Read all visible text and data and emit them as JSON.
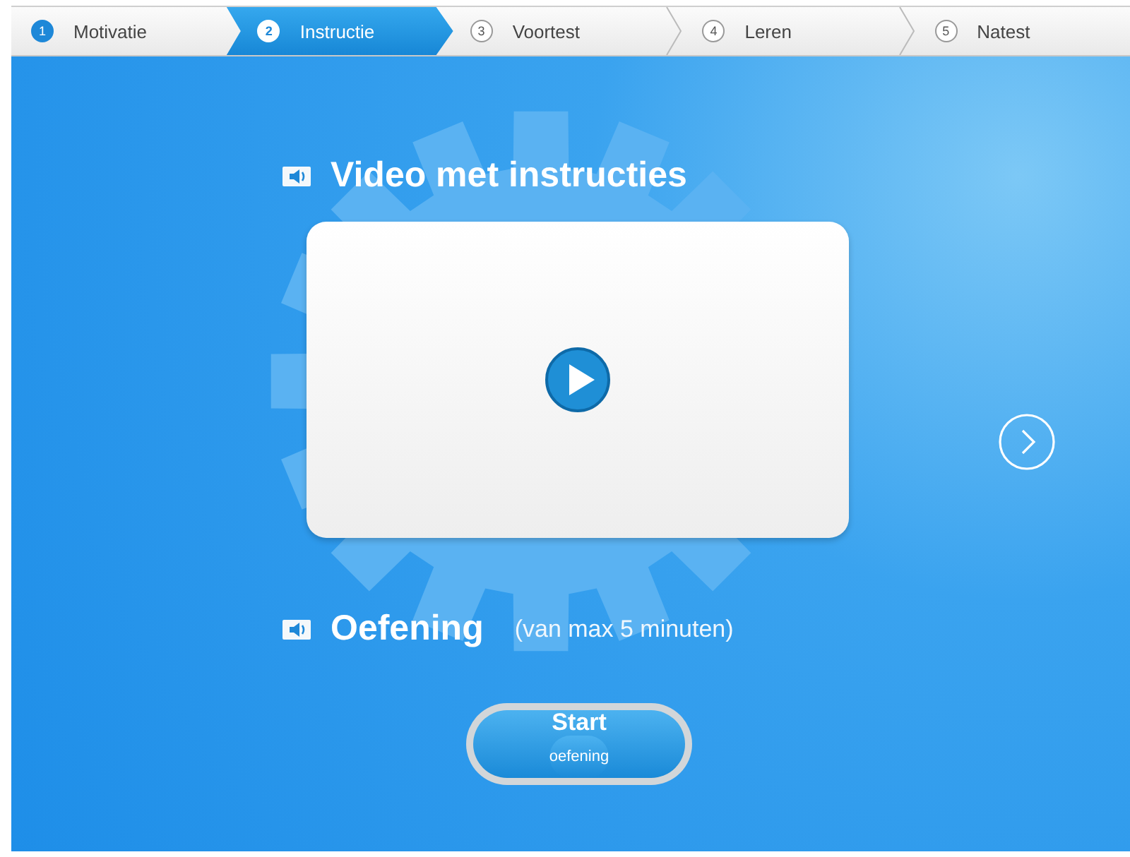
{
  "steps": [
    {
      "number": "1",
      "label": "Motivatie",
      "done": true,
      "selected": false
    },
    {
      "number": "2",
      "label": "Instructie",
      "done": false,
      "selected": true
    },
    {
      "number": "3",
      "label": "Voortest",
      "done": false,
      "selected": false
    },
    {
      "number": "4",
      "label": "Leren",
      "done": false,
      "selected": false
    },
    {
      "number": "5",
      "label": "Natest",
      "done": false,
      "selected": false
    }
  ],
  "video_section": {
    "title": "Video met instructies"
  },
  "exercise_section": {
    "title": "Oefening",
    "note": "(van max 5 minuten)"
  },
  "start_button": {
    "label": "Start",
    "sublabel": "oefening"
  }
}
